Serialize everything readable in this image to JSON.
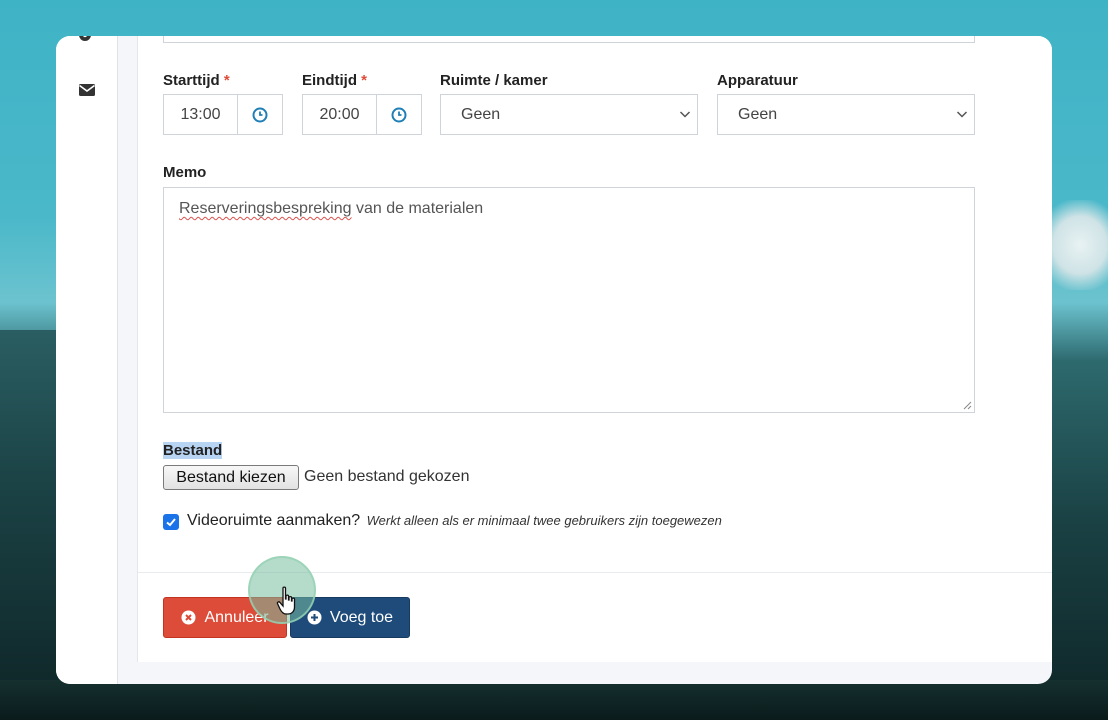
{
  "sidebar": {
    "icons": [
      "gear-icon",
      "envelope-icon"
    ]
  },
  "form": {
    "start_time": {
      "label": "Starttijd",
      "required_mark": "*",
      "value": "13:00"
    },
    "end_time": {
      "label": "Eindtijd",
      "required_mark": "*",
      "value": "20:00"
    },
    "room": {
      "label": "Ruimte / kamer",
      "selected": "Geen"
    },
    "equipment": {
      "label": "Apparatuur",
      "selected": "Geen"
    },
    "memo": {
      "label": "Memo",
      "value_misspelled": "Reserveringsbespreking",
      "value_rest": " van de materialen"
    },
    "file": {
      "label": "Bestand",
      "button_label": "Bestand kiezen",
      "status": "Geen bestand gekozen"
    },
    "video_room": {
      "checked": true,
      "label": "Videoruimte aanmaken?",
      "hint": "Werkt alleen als er minimaal twee gebruikers zijn toegewezen"
    }
  },
  "footer": {
    "cancel_label": "Annuleer",
    "submit_label": "Voeg toe"
  },
  "colors": {
    "danger": "#dd4b39",
    "primary": "#1e4b7a",
    "clock_icon": "#1f7fb6",
    "checkbox": "#1a73e8"
  }
}
